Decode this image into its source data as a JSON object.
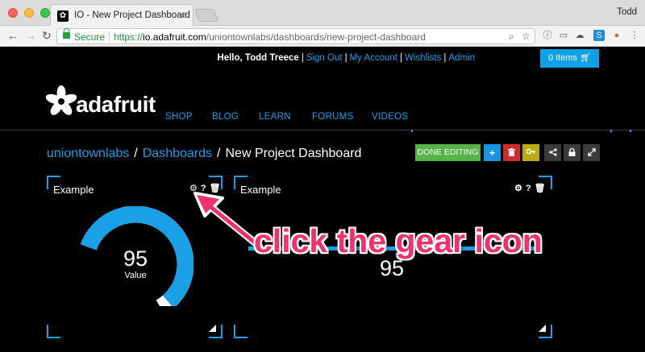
{
  "browser": {
    "tab_title": "IO - New Project Dashboard",
    "profile_name": "Todd",
    "secure_label": "Secure",
    "url_scheme": "https://",
    "url_host": "io.adafruit.com",
    "url_path": "/uniontownlabs/dashboards/new-project-dashboard"
  },
  "userbar": {
    "greeting": "Hello, Todd Treece",
    "sign_out": "Sign Out",
    "my_account": "My Account",
    "wishlists": "Wishlists",
    "admin": "Admin",
    "cart_label": "0 Items"
  },
  "logo": {
    "text": "adafruit"
  },
  "nav": {
    "items": [
      "SHOP",
      "BLOG",
      "LEARN",
      "FORUMS",
      "VIDEOS"
    ]
  },
  "breadcrumb": {
    "user": "uniontownlabs",
    "dashboards": "Dashboards",
    "current": "New Project Dashboard"
  },
  "toolbar": {
    "done_label": "DONE EDITING",
    "plus_label": "+"
  },
  "blocks": [
    {
      "title": "Example",
      "type": "gauge",
      "value": "95",
      "value_fraction": 0.95,
      "label": "Value"
    },
    {
      "title": "Example",
      "type": "line",
      "value": "95"
    }
  ],
  "annotation": {
    "text": "click the gear icon"
  },
  "colors": {
    "accent_blue": "#1aa0e6",
    "done_green": "#55b34a",
    "delete_red": "#d22b2b",
    "key_yellow": "#b9ad10",
    "callout_pink": "#f0306f"
  }
}
